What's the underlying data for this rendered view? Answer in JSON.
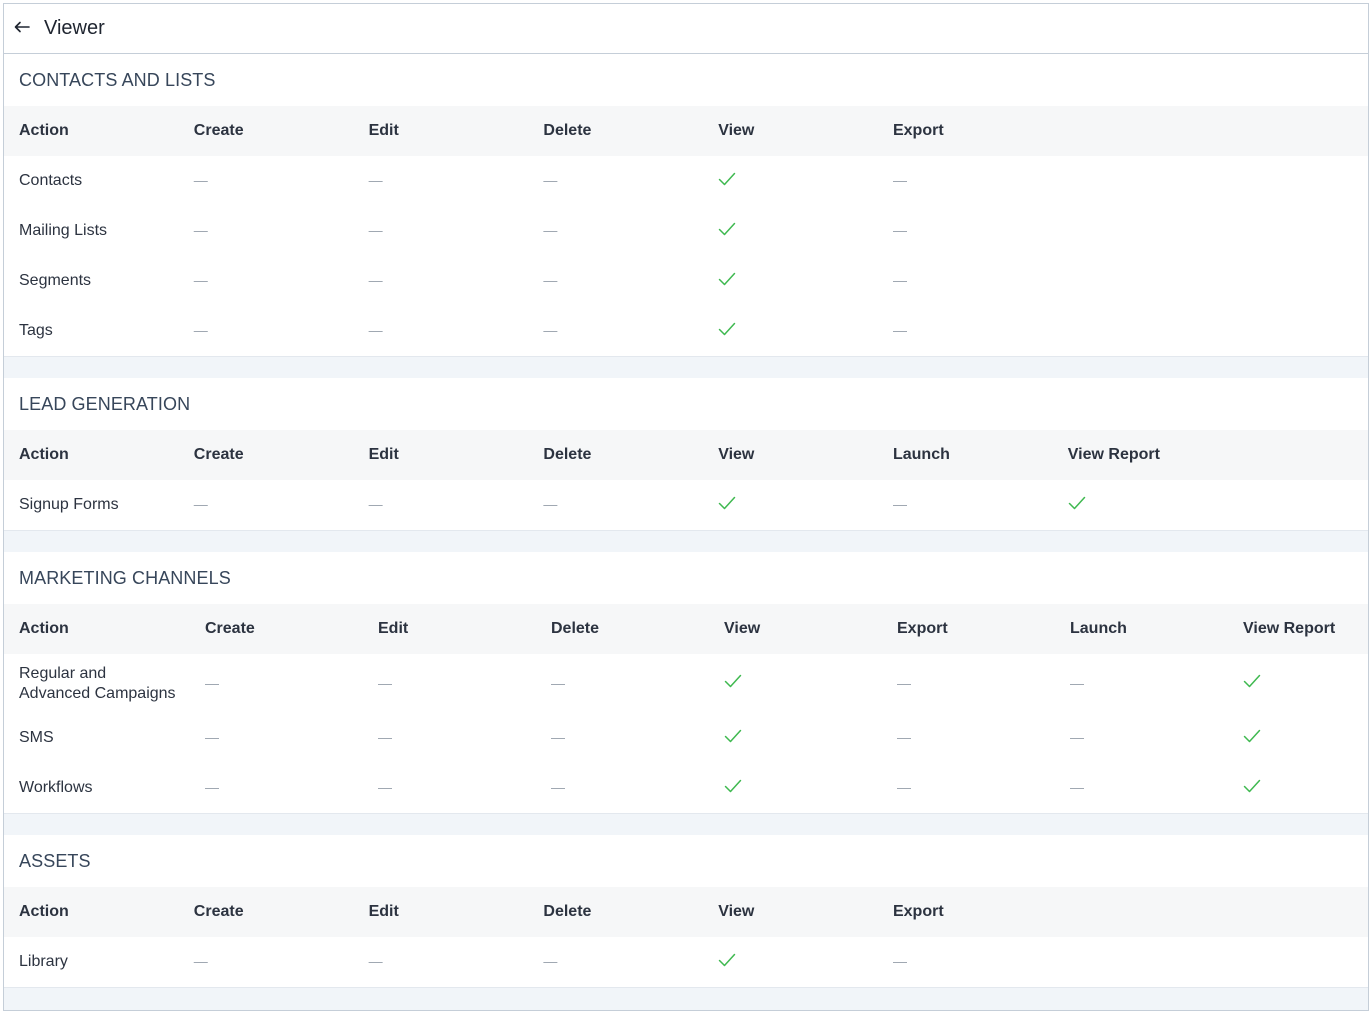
{
  "header": {
    "title": "Viewer",
    "back_icon": "arrow-left-icon"
  },
  "dash": "—",
  "sections": [
    {
      "title": "CONTACTS AND LISTS",
      "columns": [
        "Action",
        "Create",
        "Edit",
        "Delete",
        "View",
        "Export"
      ],
      "rows": [
        {
          "name": "Contacts",
          "values": [
            false,
            false,
            false,
            true,
            false
          ]
        },
        {
          "name": "Mailing Lists",
          "values": [
            false,
            false,
            false,
            true,
            false
          ]
        },
        {
          "name": "Segments",
          "values": [
            false,
            false,
            false,
            true,
            false
          ]
        },
        {
          "name": "Tags",
          "values": [
            false,
            false,
            false,
            true,
            false
          ]
        }
      ]
    },
    {
      "title": "LEAD GENERATION",
      "columns": [
        "Action",
        "Create",
        "Edit",
        "Delete",
        "View",
        "Launch",
        "View Report"
      ],
      "rows": [
        {
          "name": "Signup Forms",
          "values": [
            false,
            false,
            false,
            true,
            false,
            true
          ]
        }
      ]
    },
    {
      "title": "MARKETING CHANNELS",
      "columns": [
        "Action",
        "Create",
        "Edit",
        "Delete",
        "View",
        "Export",
        "Launch",
        "View Report"
      ],
      "rows": [
        {
          "name": "Regular and\nAdvanced Campaigns",
          "values": [
            false,
            false,
            false,
            true,
            false,
            false,
            true
          ]
        },
        {
          "name": "SMS",
          "values": [
            false,
            false,
            false,
            true,
            false,
            false,
            true
          ]
        },
        {
          "name": "Workflows",
          "values": [
            false,
            false,
            false,
            true,
            false,
            false,
            true
          ]
        }
      ]
    },
    {
      "title": "ASSETS",
      "columns": [
        "Action",
        "Create",
        "Edit",
        "Delete",
        "View",
        "Export"
      ],
      "rows": [
        {
          "name": "Library",
          "values": [
            false,
            false,
            false,
            true,
            false
          ]
        }
      ]
    }
  ],
  "colors": {
    "check": "#3fb950",
    "dash": "#9aa3ad",
    "border": "#c5ced8"
  }
}
